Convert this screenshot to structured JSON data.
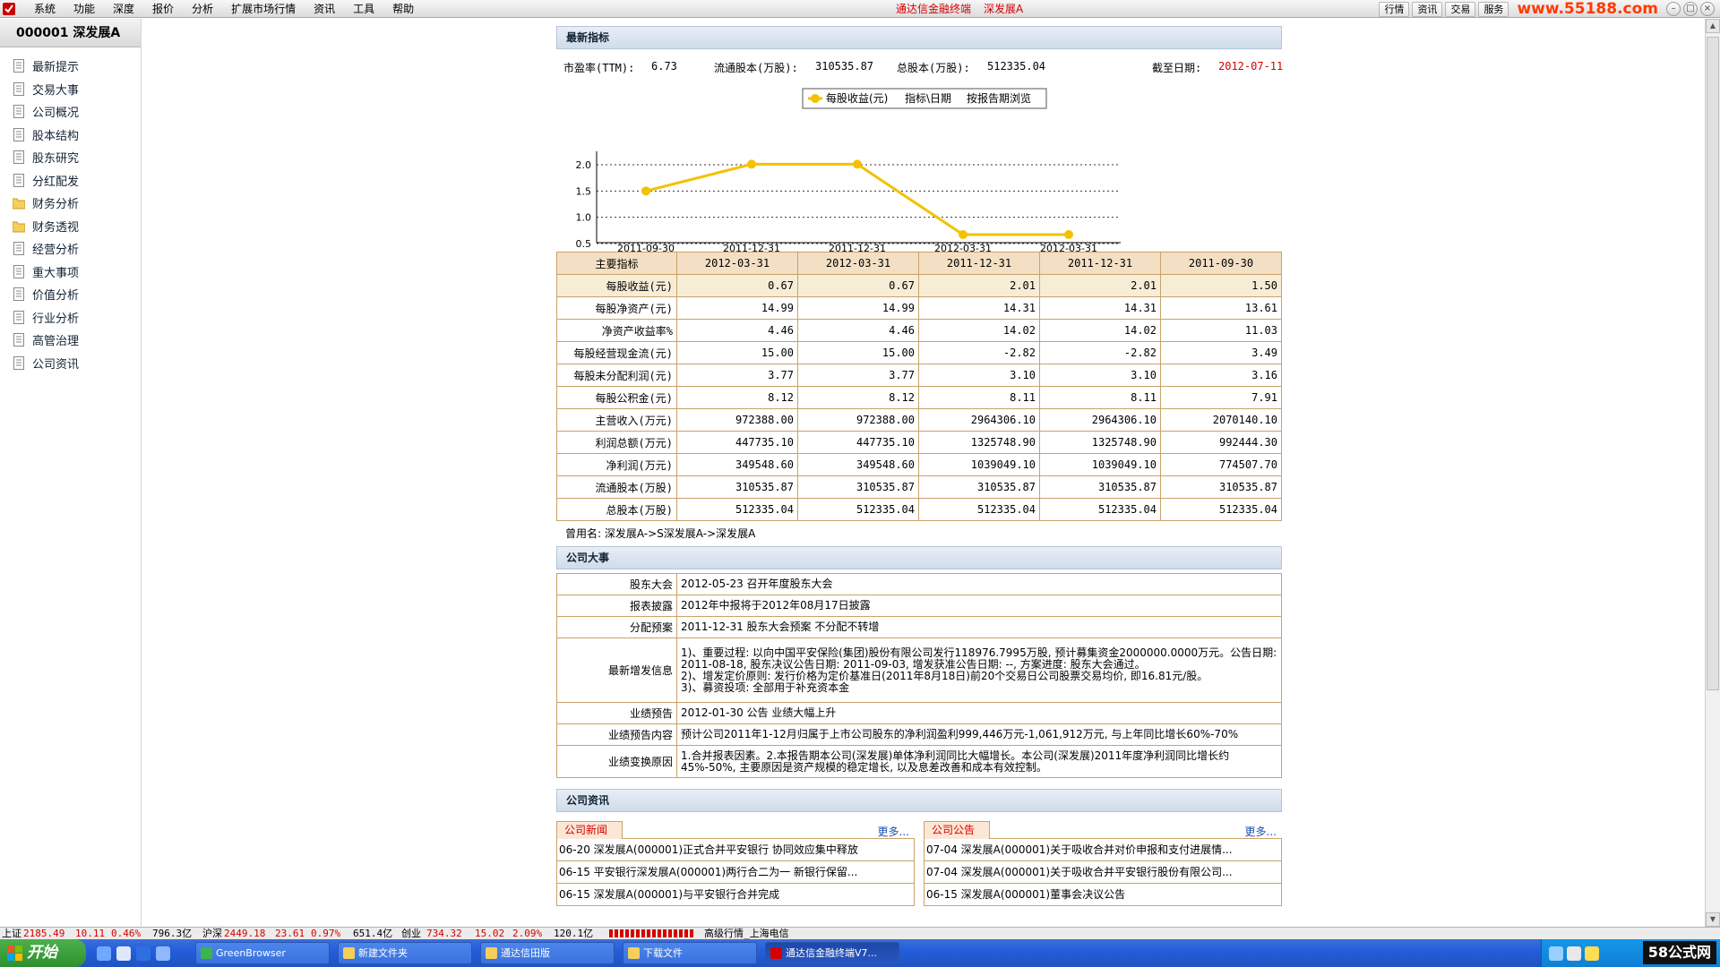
{
  "menubar": {
    "items": [
      "系统",
      "功能",
      "深度",
      "报价",
      "分析",
      "扩展市场行情",
      "资讯",
      "工具",
      "帮助"
    ],
    "title_app": "通达信金融终端",
    "title_stock": "深发展A",
    "right_buttons": [
      "行情",
      "资讯",
      "交易",
      "服务"
    ],
    "watermark": "www.55188.com"
  },
  "sidebar": {
    "stock_header": "000001 深发展A",
    "items": [
      {
        "label": "最新提示",
        "icon": "doc-icon"
      },
      {
        "label": "交易大事",
        "icon": "doc-icon"
      },
      {
        "label": "公司概况",
        "icon": "doc-icon"
      },
      {
        "label": "股本结构",
        "icon": "doc-icon"
      },
      {
        "label": "股东研究",
        "icon": "doc-icon"
      },
      {
        "label": "分红配发",
        "icon": "doc-icon"
      },
      {
        "label": "财务分析",
        "icon": "folder-icon"
      },
      {
        "label": "财务透视",
        "icon": "folder-icon"
      },
      {
        "label": "经营分析",
        "icon": "doc-icon"
      },
      {
        "label": "重大事项",
        "icon": "doc-icon"
      },
      {
        "label": "价值分析",
        "icon": "doc-icon"
      },
      {
        "label": "行业分析",
        "icon": "doc-icon"
      },
      {
        "label": "高管治理",
        "icon": "doc-icon"
      },
      {
        "label": "公司资讯",
        "icon": "doc-icon"
      }
    ]
  },
  "latest": {
    "header": "最新指标",
    "pe_label": "市盈率(TTM):",
    "pe_value": "6.73",
    "float_label": "流通股本(万股):",
    "float_value": "310535.87",
    "total_label": "总股本(万股):",
    "total_value": "512335.04",
    "as_of_label": "截至日期:",
    "as_of_value": "2012-07-11"
  },
  "chart_data": {
    "type": "line",
    "legend": "每股收益(元)",
    "toolbar_items": [
      "指标\\日期",
      "按报告期浏览"
    ],
    "categories": [
      "2011-09-30",
      "2011-12-31",
      "2011-12-31",
      "2012-03-31",
      "2012-03-31"
    ],
    "series": [
      {
        "name": "每股收益(元)",
        "values": [
          1.5,
          2.01,
          2.01,
          0.67,
          0.67
        ]
      }
    ],
    "y_ticks": [
      "2.0",
      "1.5",
      "1.0",
      "0.5"
    ],
    "ylim": [
      0.5,
      2.0
    ],
    "grid": true,
    "legend_position": "top-center",
    "color": "#f2c200"
  },
  "fin_table": {
    "corner": "主要指标",
    "dates": [
      "2012-03-31",
      "2012-03-31",
      "2011-12-31",
      "2011-12-31",
      "2011-09-30"
    ],
    "rows": [
      {
        "label": "每股收益(元)",
        "values": [
          "0.67",
          "0.67",
          "2.01",
          "2.01",
          "1.50"
        ]
      },
      {
        "label": "每股净资产(元)",
        "values": [
          "14.99",
          "14.99",
          "14.31",
          "14.31",
          "13.61"
        ]
      },
      {
        "label": "净资产收益率%",
        "values": [
          "4.46",
          "4.46",
          "14.02",
          "14.02",
          "11.03"
        ]
      },
      {
        "label": "每股经营现金流(元)",
        "values": [
          "15.00",
          "15.00",
          "-2.82",
          "-2.82",
          "3.49"
        ]
      },
      {
        "label": "每股未分配利润(元)",
        "values": [
          "3.77",
          "3.77",
          "3.10",
          "3.10",
          "3.16"
        ]
      },
      {
        "label": "每股公积金(元)",
        "values": [
          "8.12",
          "8.12",
          "8.11",
          "8.11",
          "7.91"
        ]
      },
      {
        "label": "主营收入(万元)",
        "values": [
          "972388.00",
          "972388.00",
          "2964306.10",
          "2964306.10",
          "2070140.10"
        ]
      },
      {
        "label": "利润总额(万元)",
        "values": [
          "447735.10",
          "447735.10",
          "1325748.90",
          "1325748.90",
          "992444.30"
        ]
      },
      {
        "label": "净利润(万元)",
        "values": [
          "349548.60",
          "349548.60",
          "1039049.10",
          "1039049.10",
          "774507.70"
        ]
      },
      {
        "label": "流通股本(万股)",
        "values": [
          "310535.87",
          "310535.87",
          "310535.87",
          "310535.87",
          "310535.87"
        ]
      },
      {
        "label": "总股本(万股)",
        "values": [
          "512335.04",
          "512335.04",
          "512335.04",
          "512335.04",
          "512335.04"
        ]
      }
    ],
    "prev_names": "曾用名: 深发展A->S深发展A->深发展A"
  },
  "events": {
    "header": "公司大事",
    "rows": [
      {
        "label": "股东大会",
        "value": "2012-05-23 召开年度股东大会"
      },
      {
        "label": "报表披露",
        "value": "2012年中报将于2012年08月17日披露"
      },
      {
        "label": "分配预案",
        "value": "2011-12-31 股东大会预案 不分配不转增"
      },
      {
        "label": "最新增发信息",
        "value": "1)、重要过程: 以向中国平安保险(集团)股份有限公司发行118976.7995万股, 预计募集资金2000000.0000万元。公告日期: 2011-08-18, 股东决议公告日期: 2011-09-03, 增发获准公告日期: --, 方案进度: 股东大会通过。\n2)、增发定价原则: 发行价格为定价基准日(2011年8月18日)前20个交易日公司股票交易均价, 即16.81元/股。\n3)、募资投项: 全部用于补充资本金"
      },
      {
        "label": "业绩预告",
        "value": "2012-01-30 公告 业绩大幅上升"
      },
      {
        "label": "业绩预告内容",
        "value": "预计公司2011年1-12月归属于上市公司股东的净利润盈利999,446万元-1,061,912万元, 与上年同比增长60%-70%"
      },
      {
        "label": "业绩变换原因",
        "value": "1.合并报表因素。2.本报告期本公司(深发展)单体净利润同比大幅增长。本公司(深发展)2011年度净利润同比增长约45%-50%, 主要原因是资产规模的稳定增长, 以及息差改善和成本有效控制。"
      }
    ]
  },
  "news": {
    "header": "公司资讯",
    "more": "更多...",
    "news_tab": "公司新闻",
    "notice_tab": "公司公告",
    "news_items": [
      "06-20 深发展A(000001)正式合并平安银行 协同效应集中释放",
      "06-15 平安银行深发展A(000001)两行合二为一 新银行保留...",
      "06-15 深发展A(000001)与平安银行合并完成"
    ],
    "notice_items": [
      "07-04 深发展A(000001)关于吸收合并对价申报和支付进展情...",
      "07-04 深发展A(000001)关于吸收合并平安银行股份有限公司...",
      "06-15 深发展A(000001)董事会决议公告"
    ]
  },
  "status": {
    "sh_label": "上证",
    "sh_value": "2185.49",
    "sh_change": "10.11",
    "sh_pct": "0.46%",
    "sh_amt": "796.3亿",
    "hs_label": "沪深",
    "hs_value": "2449.18",
    "hs_change": "23.61",
    "hs_pct": "0.97%",
    "hs_amt": "651.4亿",
    "cy_label": "创业",
    "cy_value": "734.32",
    "cy_change": "15.02",
    "cy_pct": "2.09%",
    "cy_amt": "120.1亿",
    "server": "高级行情_上海电信"
  },
  "taskbar": {
    "start": "开始",
    "tasks": [
      "GreenBrowser",
      "新建文件夹",
      "通达信田版",
      "下载文件",
      "通达信金融终端V7..."
    ],
    "brand": "58公式网"
  }
}
